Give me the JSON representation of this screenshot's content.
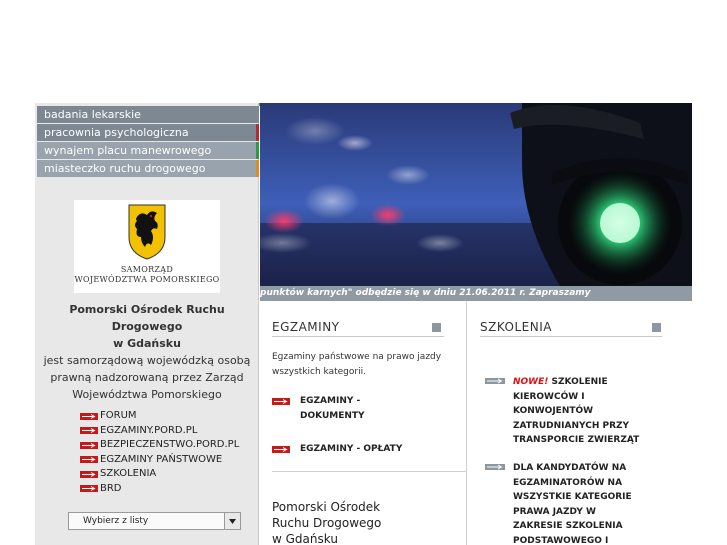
{
  "colors": {
    "menu_bg": "#7d8893",
    "menu_bg_alt": "#99a3ad",
    "accent_red": "#c51a1a",
    "accent_green": "#2e9a3a",
    "accent_blue": "#2f5fb5",
    "accent_orange": "#e08b1f",
    "ticker_bg": "#8f9aa4"
  },
  "menu": [
    {
      "label": "badania lekarskie",
      "accent": "#7d8893"
    },
    {
      "label": "pracownia psychologiczna",
      "accent": "#b32b2b"
    },
    {
      "label": "wynajem placu manewrowego",
      "accent": "#2e9a3a"
    },
    {
      "label": "miasteczko ruchu drogowego",
      "accent": "#e08b1f"
    }
  ],
  "logo": {
    "line1": "SAMORZĄD",
    "line2": "WOJEWÓDZTWA POMORSKIEGO"
  },
  "org": {
    "name_line1": "Pomorski Ośrodek Ruchu Drogowego",
    "name_line2": "w Gdańsku",
    "desc_line1": "jest samorządową wojewódzką osobą",
    "desc_line2": "prawną nadzorowaną przez Zarząd",
    "desc_line3": "Województwa Pomorskiego"
  },
  "links": [
    "FORUM",
    "EGZAMINY.PORD.PL",
    "BEZPIECZENSTWO.PORD.PL",
    "EGZAMINY PAŃSTWOWE",
    "SZKOLENIA",
    "BRD"
  ],
  "select": {
    "value": "Wybierz z listy"
  },
  "ticker": "punktów karnych\" odbędzie się w dniu 21.06.2011 r. Zapraszamy",
  "middle": {
    "title": "EGZAMINY",
    "desc": "Egzaminy państwowe na prawo jazdy wszystkich kategorii.",
    "links": [
      {
        "line1": "EGZAMINY -",
        "line2": "DOKUMENTY"
      },
      {
        "line1": "EGZAMINY - OPŁATY",
        "line2": ""
      }
    ],
    "org_line1": "Pomorski Ośrodek",
    "org_line2": "Ruchu Drogowego",
    "org_line3": "w Gdańsku"
  },
  "right": {
    "title": "SZKOLENIA",
    "items": [
      {
        "new": "NOWE!",
        "text": "SZKOLENIE KIEROWCÓW I KONWOJENTÓW ZATRUDNIANYCH PRZY TRANSPORCIE ZWIERZĄT"
      },
      {
        "new": "",
        "text": "DLA KANDYDATÓW NA EGZAMINATORÓW NA WSZYSTKIE KATEGORIE PRAWA JAZDY W ZAKRESIE SZKOLENIA PODSTAWOWEGO I DODATKOWEGO"
      }
    ]
  }
}
